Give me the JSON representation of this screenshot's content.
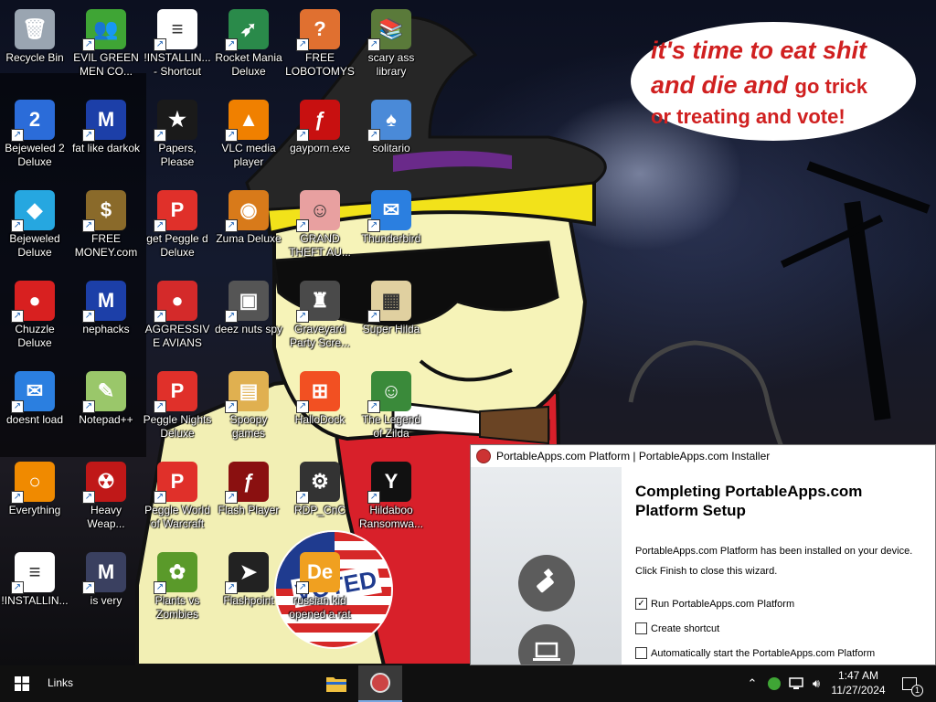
{
  "wallpaper": {
    "speech_line1": "it's time to eat shit",
    "speech_line2": "and die and",
    "speech_line2_small": "go trick",
    "speech_line3": "or treating and vote!",
    "sticker_text": "VOTED"
  },
  "desktop_icons": [
    {
      "label": "Recycle Bin",
      "icon": "recycle-bin-icon",
      "color": "#9aa5b1",
      "glyph": "🗑"
    },
    {
      "label": "Bejeweled 2 Deluxe",
      "icon": "bejeweled2-icon",
      "color": "#2b6cd9",
      "glyph": "2"
    },
    {
      "label": "Bejeweled Deluxe",
      "icon": "diamond-icon",
      "color": "#26a7e0",
      "glyph": "◆"
    },
    {
      "label": "Chuzzle Deluxe",
      "icon": "chuzzle-icon",
      "color": "#d82020",
      "glyph": "●"
    },
    {
      "label": "doesnt load",
      "icon": "thunderbird-icon",
      "color": "#2b7fe0",
      "glyph": "✉"
    },
    {
      "label": "Everything",
      "icon": "everything-search-icon",
      "color": "#f08a00",
      "glyph": "○"
    },
    {
      "label": "!INSTALLIN...",
      "icon": "document-icon",
      "color": "#ffffff",
      "glyph": "≡"
    },
    {
      "label": "EVIL GREEN MEN CO...",
      "icon": "msn-messenger-icon",
      "color": "#3fa535",
      "glyph": "👥"
    },
    {
      "label": "fat like darkok",
      "icon": "mpi-icon",
      "color": "#1c3fa8",
      "glyph": "M"
    },
    {
      "label": "FREE MONEY.com",
      "icon": "money-bag-icon",
      "color": "#8a6a2a",
      "glyph": "$"
    },
    {
      "label": "nephacks",
      "icon": "mpi-icon",
      "color": "#1c3fa8",
      "glyph": "M"
    },
    {
      "label": "Notepad++",
      "icon": "notepad-plus-plus-icon",
      "color": "#9ac76a",
      "glyph": "✎"
    },
    {
      "label": "Heavy Weap...",
      "icon": "radiation-icon",
      "color": "#c01818",
      "glyph": "☢"
    },
    {
      "label": "is very",
      "icon": "mpi-icon",
      "color": "#3a4060",
      "glyph": "M"
    },
    {
      "label": "!INSTALLIN... - Shortcut",
      "icon": "document-icon",
      "color": "#ffffff",
      "glyph": "≡"
    },
    {
      "label": "Papers, Please",
      "icon": "papers-please-icon",
      "color": "#1a1a1a",
      "glyph": "★"
    },
    {
      "label": "get Peggle d Deluxe",
      "icon": "peggle-icon",
      "color": "#e0302a",
      "glyph": "P"
    },
    {
      "label": "AGGRESSIVE AVIANS",
      "icon": "angry-bird-icon",
      "color": "#d42a2a",
      "glyph": "●"
    },
    {
      "label": "Peggle Nights Deluxe",
      "icon": "peggle-icon",
      "color": "#e0302a",
      "glyph": "P"
    },
    {
      "label": "Peggle World of Warcraft",
      "icon": "peggle-icon",
      "color": "#e0302a",
      "glyph": "P"
    },
    {
      "label": "Plants vs Zombies",
      "icon": "plants-vs-zombies-icon",
      "color": "#5a9a2a",
      "glyph": "✿"
    },
    {
      "label": "Rocket Mania Deluxe",
      "icon": "rocket-mania-icon",
      "color": "#2a8a4a",
      "glyph": "➶"
    },
    {
      "label": "VLC media player",
      "icon": "vlc-icon",
      "color": "#f08000",
      "glyph": "▲"
    },
    {
      "label": "Zuma Deluxe",
      "icon": "zuma-icon",
      "color": "#d87a1a",
      "glyph": "◉"
    },
    {
      "label": "deez nuts spy",
      "icon": "windows-stack-icon",
      "color": "#555555",
      "glyph": "▣"
    },
    {
      "label": "Spoopy games",
      "icon": "folder-icon",
      "color": "#e0b050",
      "glyph": "▤"
    },
    {
      "label": "Flash Player",
      "icon": "flash-icon",
      "color": "#8a1010",
      "glyph": "ƒ"
    },
    {
      "label": "Flashpoint",
      "icon": "flashpoint-icon",
      "color": "#222222",
      "glyph": "➤"
    },
    {
      "label": "FREE LOBOTOMYS",
      "icon": "brain-icon",
      "color": "#e07030",
      "glyph": "?"
    },
    {
      "label": "gayporn.exe",
      "icon": "flash-icon",
      "color": "#c81010",
      "glyph": "ƒ"
    },
    {
      "label": "GRAND THEFT AU...",
      "icon": "anime-girl-icon",
      "color": "#e8a0a0",
      "glyph": "☺"
    },
    {
      "label": "Graveyard Party Scre...",
      "icon": "game-icon",
      "color": "#4a4a4a",
      "glyph": "♜"
    },
    {
      "label": "HalloDock",
      "icon": "windows-shield-icon",
      "color": "#f25022",
      "glyph": "⊞"
    },
    {
      "label": "RDP_CnC",
      "icon": "remote-desktop-icon",
      "color": "#333333",
      "glyph": "⚙"
    },
    {
      "label": "russian kid opened a rat",
      "icon": "dreamweaver-icon",
      "color": "#f0a020",
      "glyph": "De"
    },
    {
      "label": "scary ass library",
      "icon": "library-icon",
      "color": "#5a7a3a",
      "glyph": "📚"
    },
    {
      "label": "solitario",
      "icon": "solitaire-icon",
      "color": "#4a8ad8",
      "glyph": "♠"
    },
    {
      "label": "Thunderbird",
      "icon": "thunderbird-icon",
      "color": "#2b7fe0",
      "glyph": "✉"
    },
    {
      "label": "Super Hilda",
      "icon": "pixel-game-icon",
      "color": "#e0d0a0",
      "glyph": "▦"
    },
    {
      "label": "The Legend of Zilda",
      "icon": "zelda-icon",
      "color": "#3a8a3a",
      "glyph": "☺"
    },
    {
      "label": "Hildaboo Ransomwa...",
      "icon": "ransomware-icon",
      "color": "#111111",
      "glyph": "Y"
    }
  ],
  "installer": {
    "title": "PortableApps.com Platform | PortableApps.com Installer",
    "heading": "Completing PortableApps.com Platform Setup",
    "body1": "PortableApps.com Platform has been installed on your device.",
    "body2": "Click Finish to close this wizard.",
    "checkbox1": "Run PortableApps.com Platform",
    "checkbox1_checked": true,
    "checkbox2": "Create shortcut",
    "checkbox2_checked": false,
    "checkbox3": "Automatically start the PortableApps.com Platform",
    "checkbox3_checked": false
  },
  "taskbar": {
    "links_label": "Links",
    "time": "1:47 AM",
    "date": "11/27/2024",
    "notification_count": "1"
  }
}
